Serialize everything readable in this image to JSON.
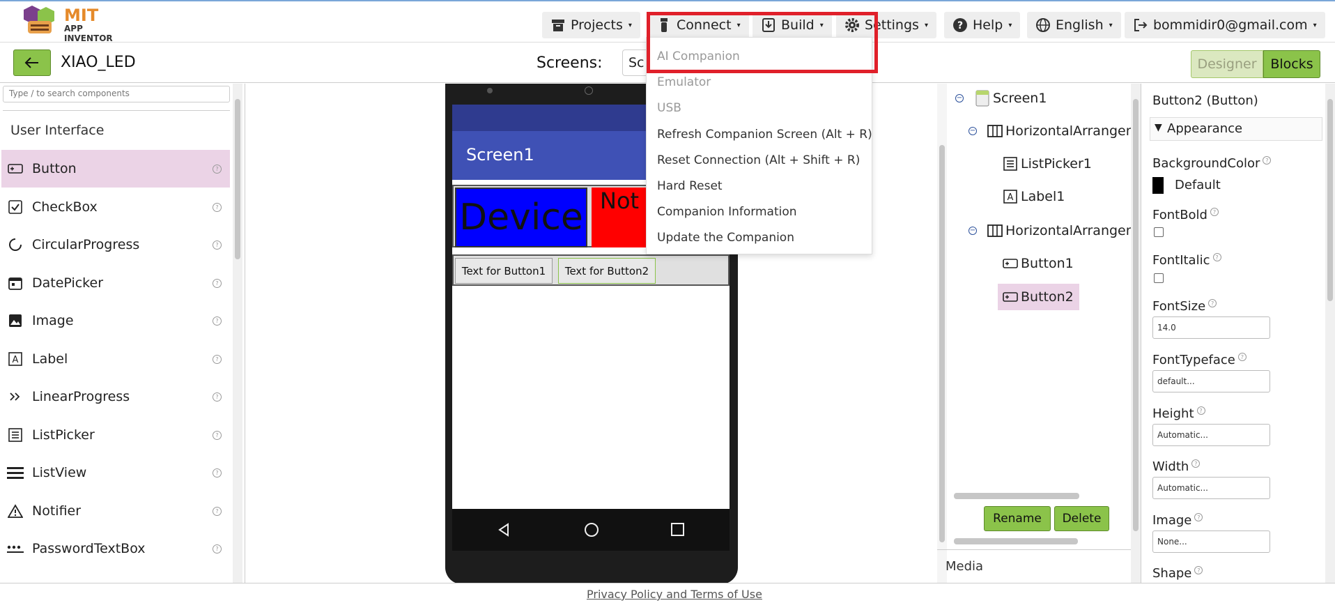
{
  "app": {
    "logo_line1": "MIT",
    "logo_line2": "APP INVENTOR"
  },
  "topnav": {
    "projects": "Projects",
    "connect": "Connect",
    "build": "Build",
    "settings": "Settings",
    "help": "Help",
    "language": "English",
    "account": "bommidir0@gmail.com"
  },
  "project": {
    "name": "XIAO_LED",
    "screens_label": "Screens:",
    "screen_value": "Sc"
  },
  "mode": {
    "designer": "Designer",
    "blocks": "Blocks"
  },
  "connect_menu": {
    "items": [
      {
        "label": "AI Companion",
        "disabled": true
      },
      {
        "label": "Emulator",
        "disabled": true
      },
      {
        "label": "USB",
        "disabled": true
      },
      {
        "label": "Refresh Companion Screen (Alt + R)",
        "disabled": false
      },
      {
        "label": "Reset Connection (Alt + Shift + R)",
        "disabled": false
      },
      {
        "label": "Hard Reset",
        "disabled": false
      },
      {
        "label": "Companion Information",
        "disabled": false
      },
      {
        "label": "Update the Companion",
        "disabled": false
      }
    ]
  },
  "palette": {
    "search_placeholder": "Type / to search components",
    "category": "User Interface",
    "items": [
      {
        "label": "Button",
        "icon": "button-icon",
        "selected": true
      },
      {
        "label": "CheckBox",
        "icon": "checkbox-icon"
      },
      {
        "label": "CircularProgress",
        "icon": "circular-progress-icon"
      },
      {
        "label": "DatePicker",
        "icon": "calendar-icon"
      },
      {
        "label": "Image",
        "icon": "image-icon"
      },
      {
        "label": "Label",
        "icon": "label-icon"
      },
      {
        "label": "LinearProgress",
        "icon": "linear-progress-icon"
      },
      {
        "label": "ListPicker",
        "icon": "list-picker-icon"
      },
      {
        "label": "ListView",
        "icon": "list-view-icon"
      },
      {
        "label": "Notifier",
        "icon": "warning-icon"
      },
      {
        "label": "PasswordTextBox",
        "icon": "password-icon"
      }
    ]
  },
  "phone": {
    "screen_title": "Screen1",
    "device_button": "Device",
    "not_button": "Not",
    "button1": "Text for Button1",
    "button2": "Text for Button2"
  },
  "tree": {
    "screen": "Screen1",
    "harr1": "HorizontalArrangem",
    "listpicker": "ListPicker1",
    "label": "Label1",
    "harr2": "HorizontalArrangem",
    "button1": "Button1",
    "button2": "Button2",
    "rename": "Rename",
    "delete": "Delete",
    "media": "Media"
  },
  "properties": {
    "title": "Button2 (Button)",
    "section": "Appearance",
    "background_color_label": "BackgroundColor",
    "background_color_value": "Default",
    "fontbold_label": "FontBold",
    "fontitalic_label": "FontItalic",
    "fontsize_label": "FontSize",
    "fontsize_value": "14.0",
    "fonttypeface_label": "FontTypeface",
    "fonttypeface_value": "default...",
    "height_label": "Height",
    "height_value": "Automatic...",
    "width_label": "Width",
    "width_value": "Automatic...",
    "image_label": "Image",
    "image_value": "None...",
    "shape_label": "Shape"
  },
  "footer": {
    "privacy": "Privacy Policy and Terms of Use"
  },
  "colors": {
    "accent_green": "#8bc34a",
    "highlight_red": "#e0202a",
    "app_bar": "#3f51b5"
  }
}
